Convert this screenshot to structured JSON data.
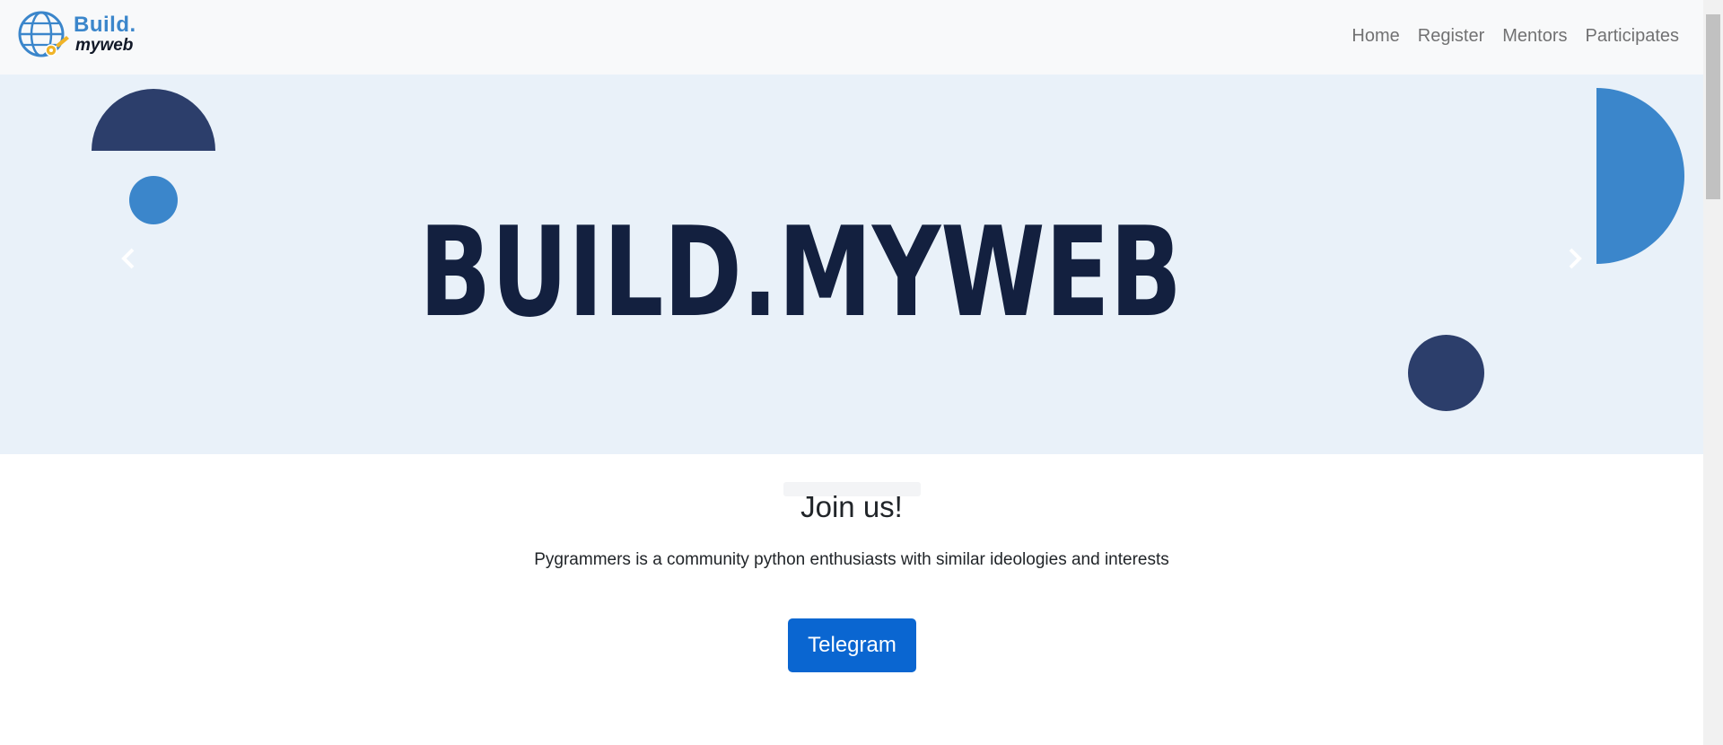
{
  "brand": {
    "line1": "Build.",
    "line2": "myweb"
  },
  "nav": {
    "items": [
      {
        "label": "Home"
      },
      {
        "label": "Register"
      },
      {
        "label": "Mentors"
      },
      {
        "label": "Participates"
      }
    ]
  },
  "hero": {
    "headline": "BUILD.MYWEB",
    "prev_icon": "chevron-left-icon",
    "next_icon": "chevron-right-icon"
  },
  "join": {
    "title": "Join us!",
    "text": "Pygrammers is a community python enthusiasts with similar ideologies and interests",
    "button_label": "Telegram"
  },
  "colors": {
    "navbar_bg": "#f8f9fa",
    "hero_bg": "#e9f1f9",
    "accent_blue": "#3b86cb",
    "navy": "#2c3e6b",
    "headline": "#13203f",
    "button": "#0a66d1"
  }
}
